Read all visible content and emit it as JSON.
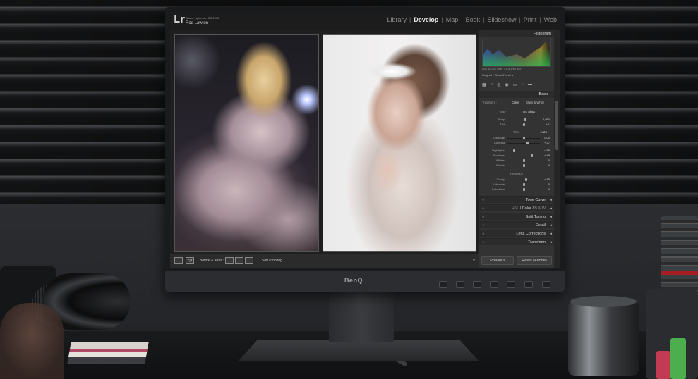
{
  "app": {
    "logo": "Lr",
    "version": "Adobe Lightroom CC 2015",
    "user": "Rod Lawton"
  },
  "modules": [
    {
      "label": "Library",
      "active": false
    },
    {
      "label": "Develop",
      "active": true
    },
    {
      "label": "Map",
      "active": false
    },
    {
      "label": "Book",
      "active": false
    },
    {
      "label": "Slideshow",
      "active": false
    },
    {
      "label": "Print",
      "active": false
    },
    {
      "label": "Web",
      "active": false
    }
  ],
  "histogram": {
    "title": "Histogram",
    "meta": "ISO 100    12 mm    f / 8.0    1/60 sec",
    "smart_preview": "Original + Smart Preview"
  },
  "basic": {
    "title": "Basic",
    "treatment_label": "Treatment :",
    "treatment_color": "Color",
    "treatment_bw": "Black & White",
    "wb_label": "WB :",
    "wb_value": "As Shot",
    "temp": {
      "label": "Temp",
      "value": "5,050",
      "position": 0.55
    },
    "tint": {
      "label": "Tint",
      "value": "+ 1",
      "position": 0.5
    },
    "tone_label": "Tone",
    "tone_auto": "Auto",
    "exposure": {
      "label": "Exposure",
      "value": "0.00",
      "position": 0.5
    },
    "contrast": {
      "label": "Contrast",
      "value": "+ 27",
      "position": 0.63
    },
    "highlights": {
      "label": "Highlights",
      "value": "− 58",
      "position": 0.21
    },
    "shadows": {
      "label": "Shadows",
      "value": "+ 48",
      "position": 0.74
    },
    "whites": {
      "label": "Whites",
      "value": "0",
      "position": 0.5
    },
    "blacks": {
      "label": "Blacks",
      "value": "0",
      "position": 0.5
    },
    "presence_label": "Presence",
    "clarity": {
      "label": "Clarity",
      "value": "+ 15",
      "position": 0.58
    },
    "vibrance": {
      "label": "Vibrance",
      "value": "0",
      "position": 0.5
    },
    "saturation": {
      "label": "Saturation",
      "value": "0",
      "position": 0.5
    }
  },
  "sections": {
    "tone_curve": "Tone Curve",
    "hsl": "HSL",
    "color": "Color",
    "bw": "B & W",
    "split_toning": "Split Toning",
    "detail": "Detail",
    "lens_corrections": "Lens Corrections",
    "transform": "Transform"
  },
  "buttons": {
    "previous": "Previous",
    "reset": "Reset (Adobe)"
  },
  "toolbar": {
    "yy": "Y|Y",
    "before_after": "Before & After :",
    "soft_proofing": "Soft Proofing"
  },
  "monitor": {
    "brand": "BenQ"
  },
  "colors": {
    "panel": "#333333",
    "active_module": "#e8e8e8",
    "inactive_module": "#8d8d8d"
  }
}
